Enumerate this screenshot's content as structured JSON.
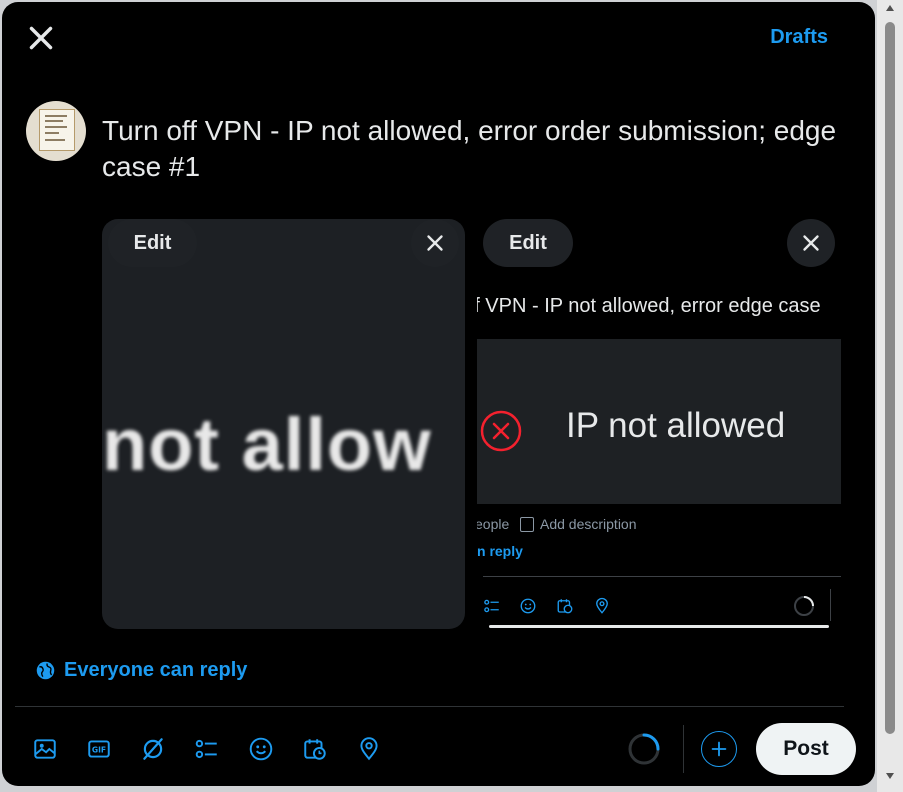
{
  "header": {
    "close_icon": "close-icon",
    "drafts_label": "Drafts"
  },
  "post": {
    "text": "Turn off VPN - IP not allowed, error order submission; edge case #1"
  },
  "media": [
    {
      "edit_label": "Edit",
      "remove_icon": "close-icon",
      "preview_text": "not allow"
    },
    {
      "edit_label": "Edit",
      "remove_icon": "close-icon",
      "screenshot": {
        "post_text": "ff VPN - IP not allowed, error edge case",
        "error_text": "IP not allowed",
        "people_text": "eople",
        "add_description": "Add description",
        "reply_text": "n reply"
      }
    }
  ],
  "reply_setting": {
    "icon": "globe-icon",
    "label": "Everyone can reply"
  },
  "toolbar": {
    "icons": [
      "image-icon",
      "gif-icon",
      "grok-icon",
      "poll-icon",
      "emoji-icon",
      "schedule-icon",
      "location-icon"
    ],
    "progress_fraction": 0.25,
    "add_icon": "plus-icon",
    "post_label": "Post"
  },
  "colors": {
    "accent": "#1d9bf0",
    "background": "#000000",
    "text": "#e7e9ea",
    "error": "#f4212e"
  }
}
